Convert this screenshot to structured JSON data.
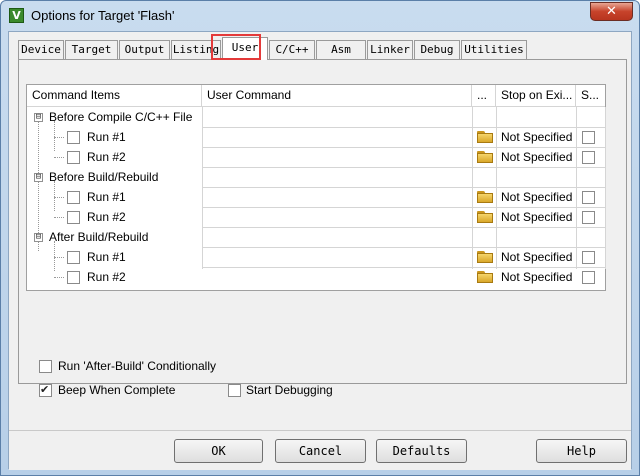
{
  "window": {
    "title": "Options for Target 'Flash'",
    "icon": "keil-uvision-icon",
    "close_glyph": "✕"
  },
  "tabs": [
    {
      "label": "Device"
    },
    {
      "label": "Target"
    },
    {
      "label": "Output"
    },
    {
      "label": "Listing"
    },
    {
      "label": "User",
      "active": true,
      "highlighted": true
    },
    {
      "label": "C/C++"
    },
    {
      "label": "Asm"
    },
    {
      "label": "Linker"
    },
    {
      "label": "Debug"
    },
    {
      "label": "Utilities"
    }
  ],
  "grid": {
    "headers": {
      "command_items": "Command Items",
      "user_command": "User Command",
      "browse": "...",
      "stop_on_exit": "Stop on Exi...",
      "s": "S..."
    },
    "groups": [
      {
        "label": "Before Compile C/C++ File",
        "expander": "⊟",
        "items": [
          {
            "label": "Run #1",
            "checked": false,
            "command": "",
            "stop": "Not Specified"
          },
          {
            "label": "Run #2",
            "checked": false,
            "command": "",
            "stop": "Not Specified"
          }
        ]
      },
      {
        "label": "Before Build/Rebuild",
        "expander": "⊟",
        "items": [
          {
            "label": "Run #1",
            "checked": false,
            "command": "",
            "stop": "Not Specified"
          },
          {
            "label": "Run #2",
            "checked": false,
            "command": "",
            "stop": "Not Specified"
          }
        ]
      },
      {
        "label": "After Build/Rebuild",
        "expander": "⊟",
        "items": [
          {
            "label": "Run #1",
            "checked": false,
            "command": "",
            "stop": "Not Specified"
          },
          {
            "label": "Run #2",
            "checked": false,
            "command": "",
            "stop": "Not Specified"
          }
        ]
      }
    ]
  },
  "options": {
    "run_after_build": {
      "label": "Run 'After-Build' Conditionally",
      "checked": false
    },
    "beep": {
      "label": "Beep When Complete",
      "checked": true
    },
    "start_debugging": {
      "label": "Start Debugging",
      "checked": false
    }
  },
  "buttons": {
    "ok": "OK",
    "cancel": "Cancel",
    "defaults": "Defaults",
    "help": "Help"
  },
  "colors": {
    "highlight": "#e43a3a",
    "close_button": "#c7432b",
    "title_bar": "#b9d1ea"
  }
}
